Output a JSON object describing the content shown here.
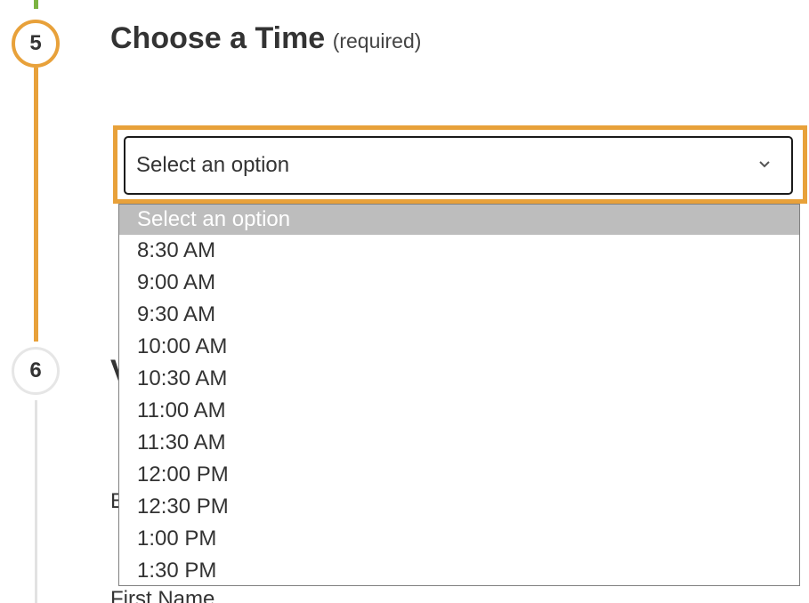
{
  "step5": {
    "number": "5",
    "title": "Choose a Time",
    "qualifier": "(required)"
  },
  "step6": {
    "number": "6"
  },
  "hidden_text": {
    "step6_title_fragment": "V",
    "field_label_fragment": "E",
    "first_name_fragment": "First Name"
  },
  "time_select": {
    "selected_label": "Select an option",
    "options": [
      "Select an option",
      "8:30 AM",
      "9:00 AM",
      "9:30 AM",
      "10:00 AM",
      "10:30 AM",
      "11:00 AM",
      "11:30 AM",
      "12:00 PM",
      "12:30 PM",
      "1:00 PM",
      "1:30 PM"
    ],
    "highlighted_index": 0
  },
  "icons": {
    "dropdown_caret": "chevron-down-icon"
  },
  "colors": {
    "accent_orange": "#e8a13a",
    "completed_green": "#7cb342",
    "inactive_gray": "#e2e2e2",
    "option_highlight": "#bdbdbd"
  }
}
